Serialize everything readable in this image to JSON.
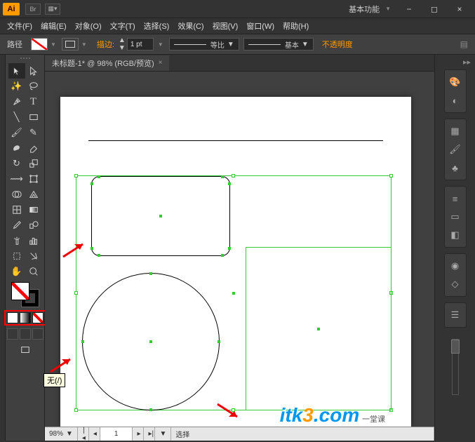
{
  "app": {
    "logo": "Ai",
    "br_icon": "Br",
    "workspace": "基本功能"
  },
  "window": {
    "min": "−",
    "max": "◻",
    "close": "×"
  },
  "menu": [
    "文件(F)",
    "编辑(E)",
    "对象(O)",
    "文字(T)",
    "选择(S)",
    "效果(C)",
    "视图(V)",
    "窗口(W)",
    "帮助(H)"
  ],
  "control": {
    "label": "路径",
    "stroke_label": "描边:",
    "stroke_weight": "1 pt",
    "profile": "等比",
    "brush": "基本",
    "opacity": "不透明度"
  },
  "document": {
    "tab": "未标题-1* @ 98% (RGB/预览)"
  },
  "status": {
    "zoom": "98%",
    "page": "1",
    "mode": "选择"
  },
  "tooltip": "无(/)",
  "watermark": {
    "text1": "itk",
    "text2": "3",
    "text3": ".com",
    "sub": "一堂课"
  }
}
